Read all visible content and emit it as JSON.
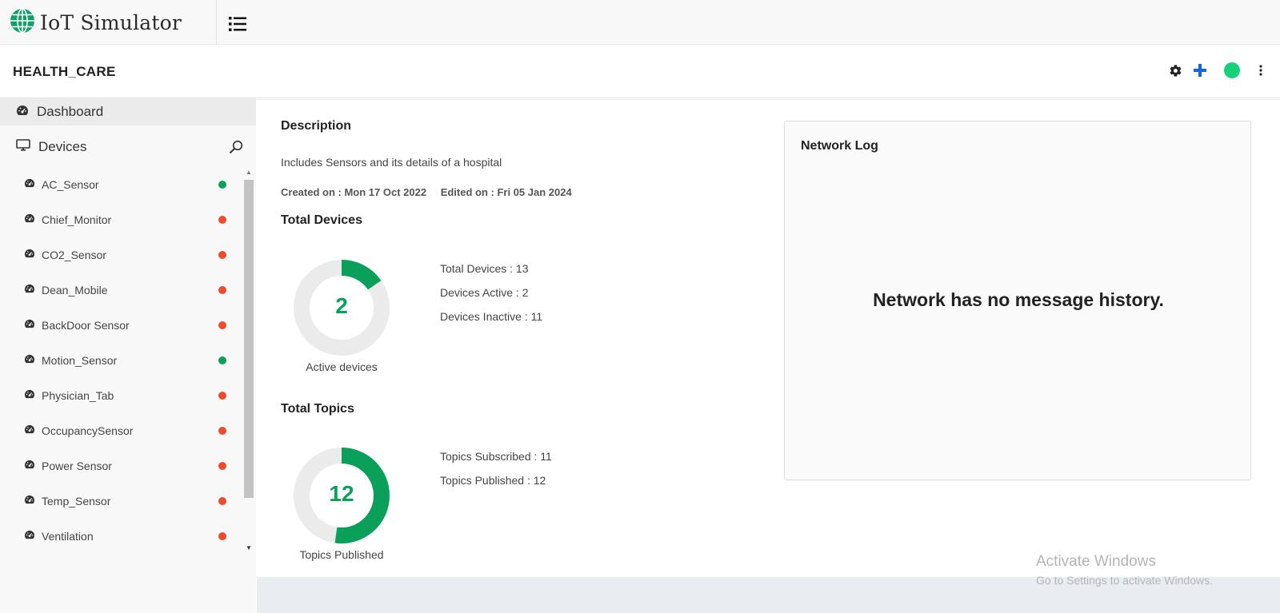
{
  "app": {
    "title": "IoT Simulator",
    "logo_icon": "globe-icon"
  },
  "header": {
    "network_name": "HEALTH_CARE",
    "status_color": "#17d17a",
    "icons": [
      "gear-icon",
      "plus-icon",
      "status-indicator",
      "kebab-menu-icon"
    ]
  },
  "sidebar": {
    "dashboard_label": "Dashboard",
    "devices_label": "Devices",
    "devices": [
      {
        "name": "AC_Sensor",
        "status": "active",
        "color": "#0aa05a"
      },
      {
        "name": "Chief_Monitor",
        "status": "inactive",
        "color": "#ee4a2c"
      },
      {
        "name": "CO2_Sensor",
        "status": "inactive",
        "color": "#ee4a2c"
      },
      {
        "name": "Dean_Mobile",
        "status": "inactive",
        "color": "#ee4a2c"
      },
      {
        "name": "BackDoor Sensor",
        "status": "inactive",
        "color": "#ee4a2c"
      },
      {
        "name": "Motion_Sensor",
        "status": "active",
        "color": "#0aa05a"
      },
      {
        "name": "Physician_Tab",
        "status": "inactive",
        "color": "#ee4a2c"
      },
      {
        "name": "OccupancySensor",
        "status": "inactive",
        "color": "#ee4a2c"
      },
      {
        "name": "Power Sensor",
        "status": "inactive",
        "color": "#ee4a2c"
      },
      {
        "name": "Temp_Sensor",
        "status": "inactive",
        "color": "#ee4a2c"
      },
      {
        "name": "Ventilation",
        "status": "inactive",
        "color": "#ee4a2c"
      }
    ]
  },
  "main": {
    "description_title": "Description",
    "description": "Includes Sensors and its details of a hospital",
    "created": "Created on : Mon 17 Oct 2022",
    "edited": "Edited on : Fri 05 Jan 2024",
    "devices_title": "Total Devices",
    "devices_donut": {
      "value": "2",
      "total": 13,
      "active": 2,
      "caption": "Active devices"
    },
    "devices_stats": [
      "Total Devices : 13",
      "Devices Active : 2",
      "Devices Inactive : 11"
    ],
    "topics_title": "Total Topics",
    "topics_donut": {
      "value": "12",
      "published": 12,
      "subscribed": 11,
      "caption": "Topics Published"
    },
    "topics_stats": [
      "Topics Subscribed : 11",
      "Topics Published : 12"
    ]
  },
  "network_log": {
    "title": "Network Log",
    "empty_message": "Network has no message history."
  },
  "watermark": {
    "line1": "Activate Windows",
    "line2": "Go to Settings to activate Windows."
  },
  "colors": {
    "accent": "#0aa05a",
    "inactive": "#ee4a2c",
    "plus": "#1565d8",
    "donut_track": "#ebebeb"
  }
}
